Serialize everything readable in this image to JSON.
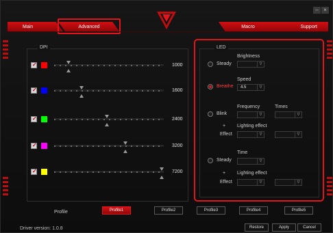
{
  "tabs": {
    "main": "Main",
    "advanced": "Advanced",
    "macro": "Macro",
    "support": "Support"
  },
  "window": {
    "minimize": "–",
    "close": "×"
  },
  "dpi": {
    "title": "DPI",
    "rows": [
      {
        "color": "#ff0000",
        "value": "1000",
        "level": 0.13
      },
      {
        "color": "#0000ff",
        "value": "1600",
        "level": 0.25
      },
      {
        "color": "#00ff00",
        "value": "2400",
        "level": 0.48
      },
      {
        "color": "#ff00ff",
        "value": "3200",
        "level": 0.65
      },
      {
        "color": "#ffff00",
        "value": "7200",
        "level": 0.98
      }
    ]
  },
  "led": {
    "title": "LED",
    "steady": "Steady",
    "breathe": "Breathe",
    "blink": "Blink",
    "steady2": "Steady",
    "brightness": "Brightness",
    "speed": "Speed",
    "speed_value": "4.5",
    "frequency": "Frequency",
    "times": "Times",
    "plus1": "+",
    "effect1": "Effect",
    "lighting_effect1": "Lighting effect",
    "time": "Time",
    "plus2": "+",
    "effect2": "Effect",
    "lighting_effect2": "Lighting effect",
    "dropdown_arrow": "∇"
  },
  "profile": {
    "label": "Profile",
    "buttons": [
      "Profile1",
      "Profile2",
      "Profile3",
      "Profile4",
      "Profile5"
    ],
    "active": "Profile1"
  },
  "footer": {
    "driver_version": "Driver version:  1.0.8",
    "restore": "Restore",
    "apply": "Apply",
    "cancel": "Cancel"
  },
  "colors": {
    "accent": "#e1151b"
  }
}
